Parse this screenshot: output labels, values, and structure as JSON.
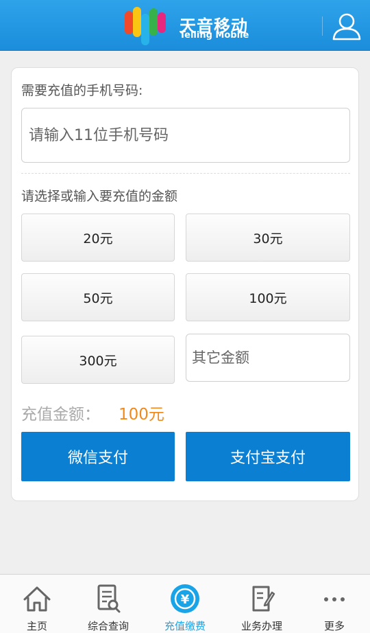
{
  "header": {
    "logo_cn": "天音移动",
    "logo_en": "Telling Mobile"
  },
  "form": {
    "phone_label": "需要充值的手机号码:",
    "phone_placeholder": "请输入11位手机号码",
    "amount_label": "请选择或输入要充值的金额",
    "amounts": [
      "20元",
      "30元",
      "50元",
      "100元",
      "300元"
    ],
    "other_placeholder": "其它金额",
    "total_label": "充值金额：",
    "total_value": "100元",
    "pay_wechat": "微信支付",
    "pay_alipay": "支付宝支付"
  },
  "nav": {
    "items": [
      {
        "label": "主页",
        "icon": "home-icon"
      },
      {
        "label": "综合查询",
        "icon": "search-document-icon"
      },
      {
        "label": "充值缴费",
        "icon": "yuan-coin-icon"
      },
      {
        "label": "业务办理",
        "icon": "clipboard-edit-icon"
      },
      {
        "label": "更多",
        "icon": "more-dots-icon"
      }
    ],
    "active_index": 2
  },
  "colors": {
    "header": "#1b8ddb",
    "pay_button": "#0b7fd2",
    "total_value": "#f08a1c",
    "nav_active": "#19a4e8"
  }
}
